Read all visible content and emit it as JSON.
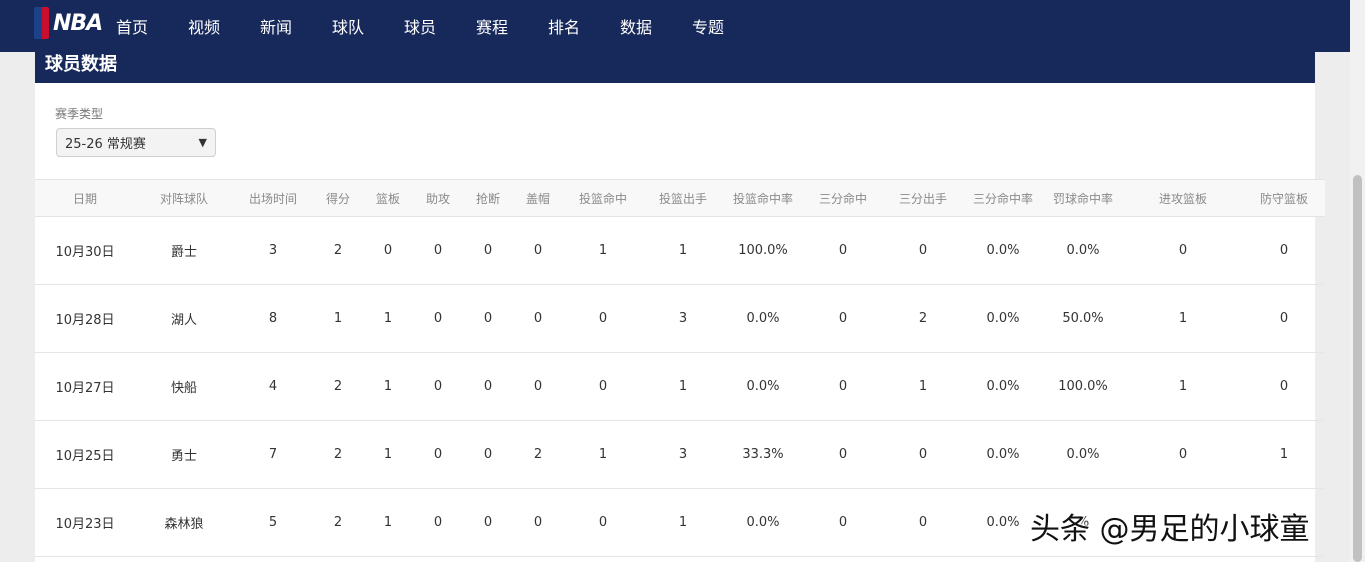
{
  "nav": {
    "logo_text": "NBA",
    "items": [
      {
        "label": "首页"
      },
      {
        "label": "视频"
      },
      {
        "label": "新闻"
      },
      {
        "label": "球队"
      },
      {
        "label": "球员"
      },
      {
        "label": "赛程"
      },
      {
        "label": "排名"
      },
      {
        "label": "数据"
      },
      {
        "label": "专题"
      }
    ],
    "active_index": 4
  },
  "section": {
    "title": "球员数据"
  },
  "filter": {
    "label": "赛季类型",
    "selected": "25-26 常规赛"
  },
  "table": {
    "headers": [
      "日期",
      "对阵球队",
      "出场时间",
      "得分",
      "篮板",
      "助攻",
      "抢断",
      "盖帽",
      "投篮命中",
      "投篮出手",
      "投篮命中率",
      "三分命中",
      "三分出手",
      "三分命中率",
      "罚球命中率",
      "进攻篮板",
      "防守篮板"
    ],
    "rows": [
      [
        "10月30日",
        "爵士",
        "3",
        "2",
        "0",
        "0",
        "0",
        "0",
        "1",
        "1",
        "100.0%",
        "0",
        "0",
        "0.0%",
        "0.0%",
        "0",
        "0"
      ],
      [
        "10月28日",
        "湖人",
        "8",
        "1",
        "1",
        "0",
        "0",
        "0",
        "0",
        "3",
        "0.0%",
        "0",
        "2",
        "0.0%",
        "50.0%",
        "1",
        "0"
      ],
      [
        "10月27日",
        "快船",
        "4",
        "2",
        "1",
        "0",
        "0",
        "0",
        "0",
        "1",
        "0.0%",
        "0",
        "1",
        "0.0%",
        "100.0%",
        "1",
        "0"
      ],
      [
        "10月25日",
        "勇士",
        "7",
        "2",
        "1",
        "0",
        "0",
        "2",
        "1",
        "3",
        "33.3%",
        "0",
        "0",
        "0.0%",
        "0.0%",
        "0",
        "1"
      ],
      [
        "10月23日",
        "森林狼",
        "5",
        "2",
        "1",
        "0",
        "0",
        "0",
        "0",
        "1",
        "0.0%",
        "0",
        "0",
        "0.0%",
        "%",
        "",
        ""
      ]
    ]
  },
  "watermark": "头条 @男足的小球童",
  "colors": {
    "nav_bg": "#17295a",
    "active_underline": "#2f7fe8"
  }
}
